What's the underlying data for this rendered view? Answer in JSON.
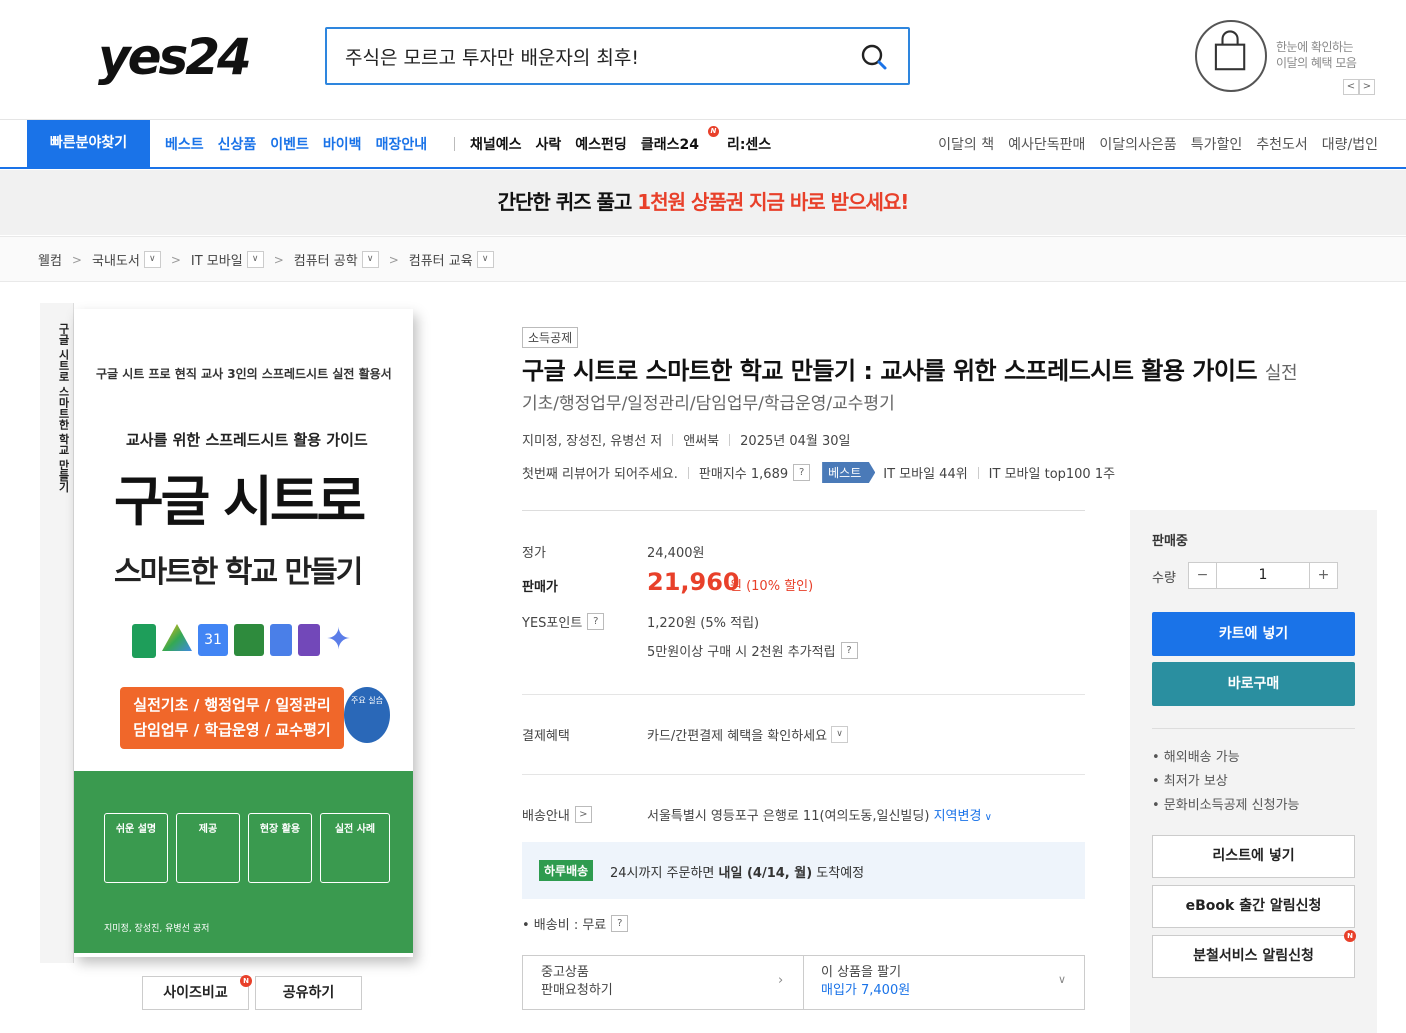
{
  "header": {
    "logo": "yes24",
    "search_value": "주식은 모르고 투자만 배운자의 최후!",
    "benefit_line1": "한눈에 확인하는",
    "benefit_line2": "이달의 혜택 모음",
    "prev": "<",
    "next": ">"
  },
  "nav": {
    "quick": "빠른분야찾기",
    "blue_items": [
      "베스트",
      "신상품",
      "이벤트",
      "바이백",
      "매장안내"
    ],
    "black_items": [
      "채널예스",
      "사락",
      "예스펀딩",
      "클래스24",
      "리:센스"
    ],
    "class_badge": "N",
    "right_items": [
      "이달의 책",
      "예사단독판매",
      "이달의사은품",
      "특가할인",
      "추천도서",
      "대량/법인"
    ]
  },
  "banner": {
    "text_before": "간단한 퀴즈 풀고 ",
    "highlight": "1천원 상품권 지금 바로 받으세요!"
  },
  "breadcrumb": {
    "items": [
      "웰컴",
      "국내도서",
      "IT 모바일",
      "컴퓨터 공학",
      "컴퓨터 교육"
    ]
  },
  "cover": {
    "line1": "구글 시트 프로 현직 교사 3인의 스프레드시트 실전 활용서",
    "line2": "교사를 위한 스프레드시트 활용 가이드",
    "title1": "구글 시트로",
    "title2": "스마트한 학교 만들기",
    "tags1": "실전기초 / 행정업무 / 일정관리",
    "tags2": "담임업무 / 학급운영 / 교수평기",
    "circle": "주요 실습",
    "box1": "쉬운 설명",
    "box2": "제공",
    "box3": "현장 활용",
    "box4": "실전 사례",
    "authors": "지미정, 장성진, 유병선 공저",
    "spine": "구글 시트로 스마트한 학교 만들기"
  },
  "cover_buttons": {
    "size": "사이즈비교",
    "share": "공유하기",
    "size_badge": "N"
  },
  "product": {
    "tag": "소득공제",
    "title": "구글 시트로 스마트한 학교 만들기 : 교사를 위한 스프레드시트 활용 가이드",
    "title_sub": "실전",
    "subline": "기초/행정업무/일정관리/담임업무/학급운영/교수평기",
    "authors": "지미정, 장성진, 유병선 저",
    "publisher": "앤써북",
    "date": "2025년 04월 30일",
    "review": "첫번째 리뷰어가 되어주세요.",
    "sales_index": "판매지수 1,689",
    "qmark": "?",
    "best": "베스트",
    "rank1": "IT 모바일 44위",
    "rank2": "IT 모바일 top100 1주"
  },
  "price": {
    "list_label": "정가",
    "list_value": "24,400원",
    "sale_label": "판매가",
    "sale_value": "21,960",
    "sale_unit": "원 (10% 할인)",
    "point_label": "YES포인트",
    "point_value": "1,220원 (5% 적립)",
    "point_extra": "5만원이상 구매 시 2천원 추가적립",
    "pay_label": "결제혜택",
    "pay_value": "카드/간편결제 혜택을 확인하세요",
    "ship_label": "배송안내",
    "ship_value": "서울특별시 영등포구 은행로 11(여의도동,일신빌딩)",
    "ship_change": "지역변경",
    "delivery_badge": "하루배송",
    "delivery_pre": "24시까지 주문하면 ",
    "delivery_bold": "내일 (4/14, 월)",
    "delivery_post": " 도착예정",
    "fee": "• 배송비 : 무료",
    "used_line1": "중고상품",
    "used_line2": "판매요청하기",
    "sell_line1": "이 상품을 팔기",
    "sell_line2": "매입가 7,400원"
  },
  "panel": {
    "status": "판매중",
    "qty_label": "수량",
    "qty": "1",
    "minus": "−",
    "plus": "+",
    "cart": "카트에 넣기",
    "buy": "바로구매",
    "features": [
      "• 해외배송 가능",
      "• 최저가 보상",
      "• 문화비소득공제 신청가능"
    ],
    "list": "리스트에 넣기",
    "ebook": "eBook 출간 알림신청",
    "split": "분철서비스 알림신청",
    "split_badge": "N"
  },
  "colors": {
    "accent": "#1a73e8",
    "sale": "#e8402a",
    "buy": "#2a8fa0",
    "green": "#3a9a4f"
  }
}
